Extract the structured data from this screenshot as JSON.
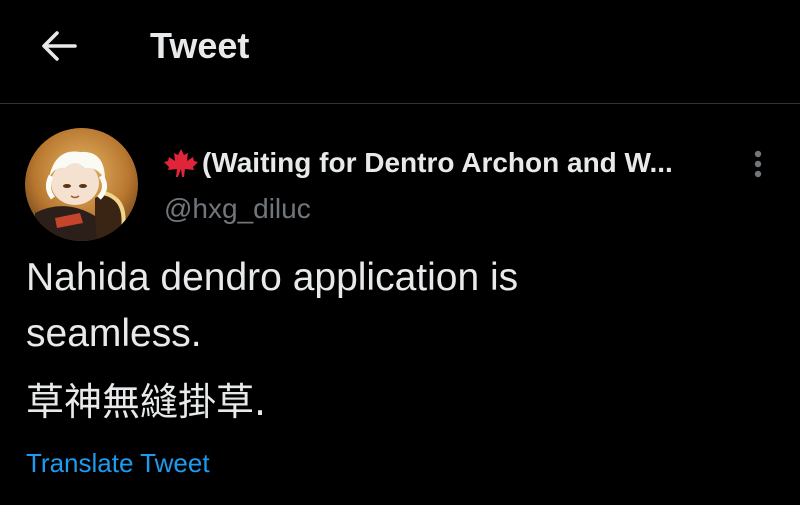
{
  "header": {
    "title": "Tweet",
    "back_icon": "arrow-left-icon"
  },
  "tweet": {
    "author": {
      "flag_icon": "maple-leaf-icon",
      "display_name": "(Waiting for Dentro Archon and W...",
      "handle": "@hxg_diluc"
    },
    "more_icon": "vertical-ellipsis-icon",
    "text_lines": [
      "Nahida dendro application is",
      "seamless."
    ],
    "text_cjk": "草神無縫掛草.",
    "translate_label": "Translate Tweet"
  },
  "colors": {
    "background": "#000000",
    "text_primary": "#e7e9ea",
    "text_secondary": "#71767b",
    "link": "#1d9bf0",
    "divider": "#2f3336",
    "flag_red": "#e0243a"
  }
}
